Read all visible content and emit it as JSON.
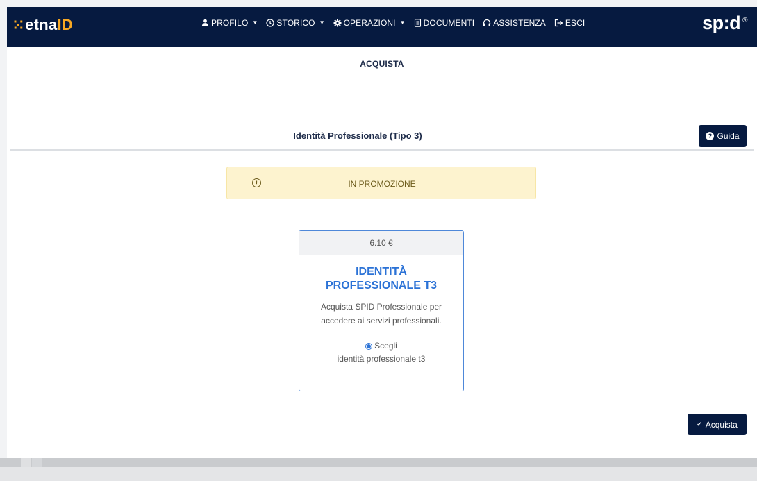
{
  "brand": {
    "dots": "⁙",
    "prefix": "etna",
    "suffix": "ID"
  },
  "nav": {
    "items": [
      {
        "label": "PROFILO",
        "icon": "user-icon",
        "glyph": "👤",
        "dropdown": true
      },
      {
        "label": "STORICO",
        "icon": "clock-icon",
        "glyph": "🕓",
        "dropdown": true
      },
      {
        "label": "OPERAZIONI",
        "icon": "gear-icon",
        "glyph": "⚙",
        "dropdown": true
      },
      {
        "label": "DOCUMENTI",
        "icon": "document-icon",
        "glyph": "🗒",
        "dropdown": false
      },
      {
        "label": "ASSISTENZA",
        "icon": "headset-icon",
        "glyph": "🎧",
        "dropdown": false
      },
      {
        "label": "ESCI",
        "icon": "logout-icon",
        "glyph": "⇥",
        "dropdown": false
      }
    ],
    "spid_logo": "sp:d",
    "spid_mark": "®"
  },
  "subheader": {
    "title": "ACQUISTA"
  },
  "section": {
    "title": "Identità Professionale (Tipo 3)",
    "guide_label": "Guida"
  },
  "promo": {
    "text": "IN PROMOZIONE",
    "icon": "!"
  },
  "card": {
    "price": "6.10 €",
    "title": "IDENTITÀ PROFESSIONALE T3",
    "description": "Acquista SPID Professionale per accedere ai servizi professionali.",
    "choose_label": "Scegli",
    "choose_value": "identità professionale t3",
    "selected": true
  },
  "buy": {
    "label": "Acquista"
  },
  "colors": {
    "navbar": "#061a40",
    "accent": "#2b72d6",
    "promo_bg": "#fdf3cf"
  }
}
